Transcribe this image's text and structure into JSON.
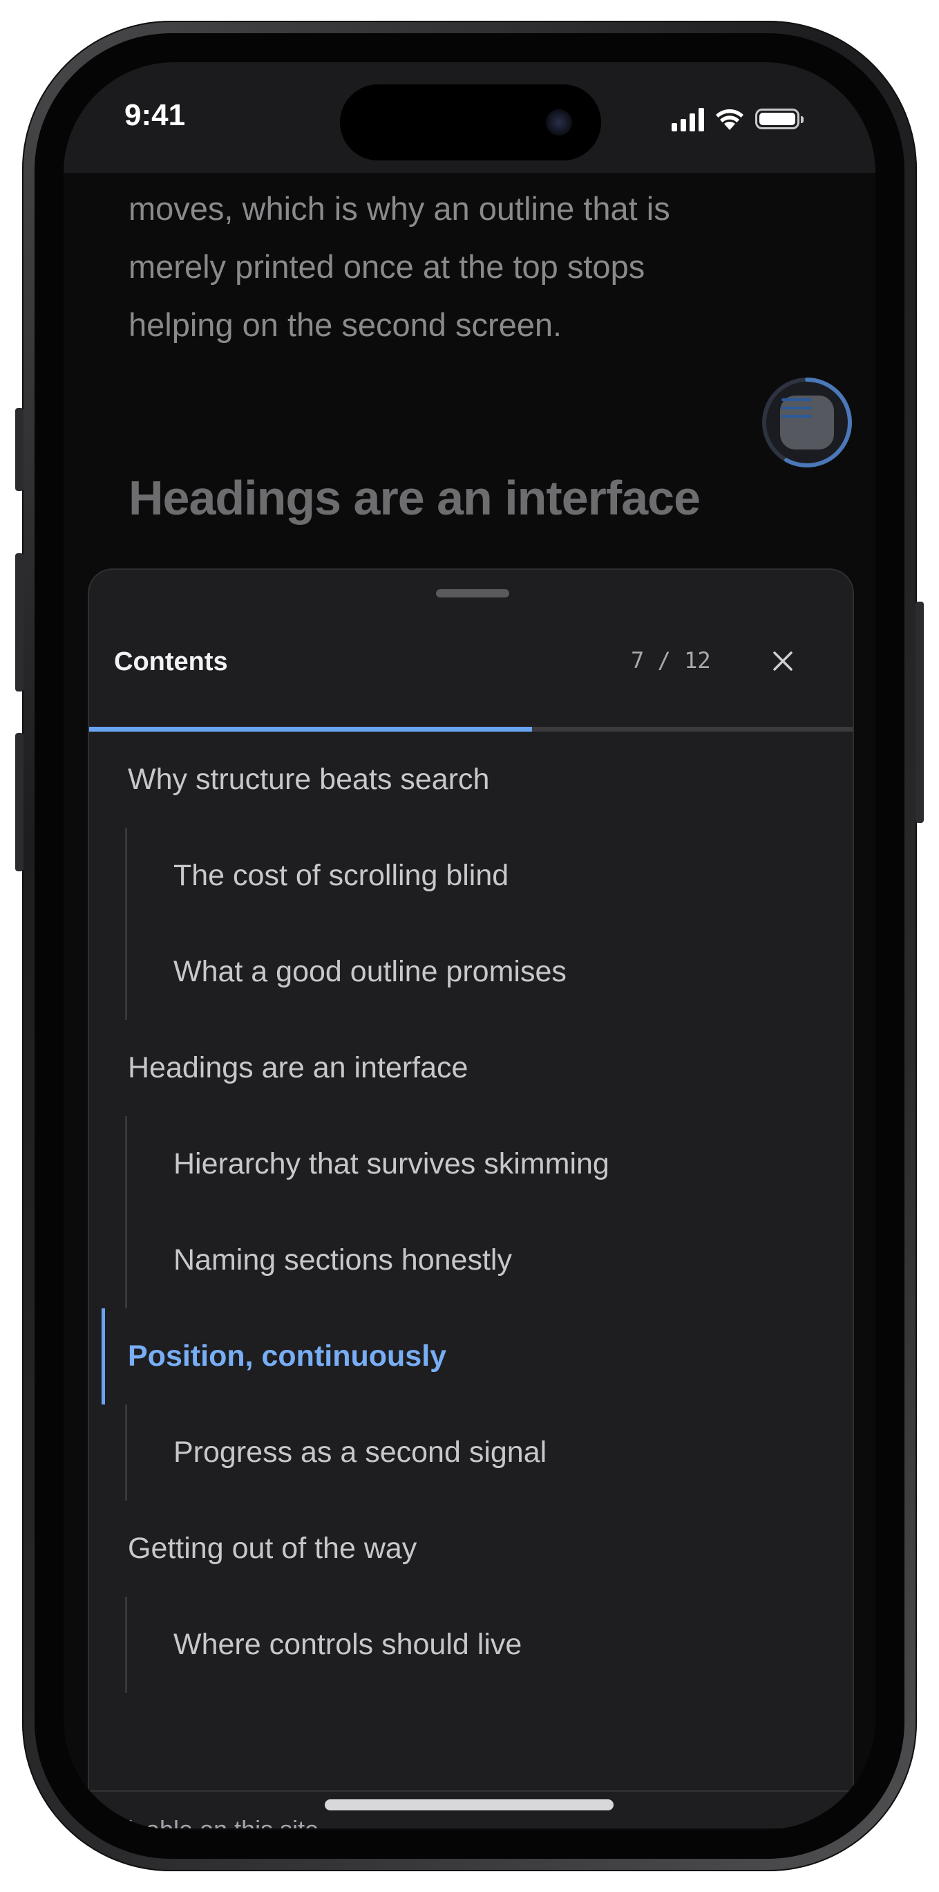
{
  "status_bar": {
    "time": "9:41"
  },
  "article": {
    "paragraph_lines": [
      "moves, which is why an outline that is",
      "merely printed once at the top stops",
      "helping on the second screen."
    ],
    "heading": "Headings are an interface"
  },
  "toc_button": {
    "icon": "list-icon",
    "reading_progress": 0.58
  },
  "sheet": {
    "title": "Contents",
    "current": "7",
    "separator": "/",
    "total": "12",
    "progress_fraction": 0.58,
    "close_icon": "close-icon",
    "items": [
      {
        "label": "Why structure beats search",
        "level": 1,
        "active": false
      },
      {
        "label": "The cost of scrolling blind",
        "level": 2,
        "active": false
      },
      {
        "label": "What a good outline promises",
        "level": 2,
        "active": false
      },
      {
        "label": "Headings are an interface",
        "level": 1,
        "active": false
      },
      {
        "label": "Hierarchy that survives skimming",
        "level": 2,
        "active": false
      },
      {
        "label": "Naming sections honestly",
        "level": 2,
        "active": false
      },
      {
        "label": "Position, continuously",
        "level": 1,
        "active": true
      },
      {
        "label": "Progress as a second signal",
        "level": 2,
        "active": false
      },
      {
        "label": "Getting out of the way",
        "level": 1,
        "active": false
      },
      {
        "label": "Where controls should live",
        "level": 2,
        "active": false
      }
    ],
    "footer_link": "Disable on this site"
  },
  "colors": {
    "accent": "#6aa3f0",
    "sheet_background": "#1e1e20",
    "page_background": "#0b0b0c"
  }
}
